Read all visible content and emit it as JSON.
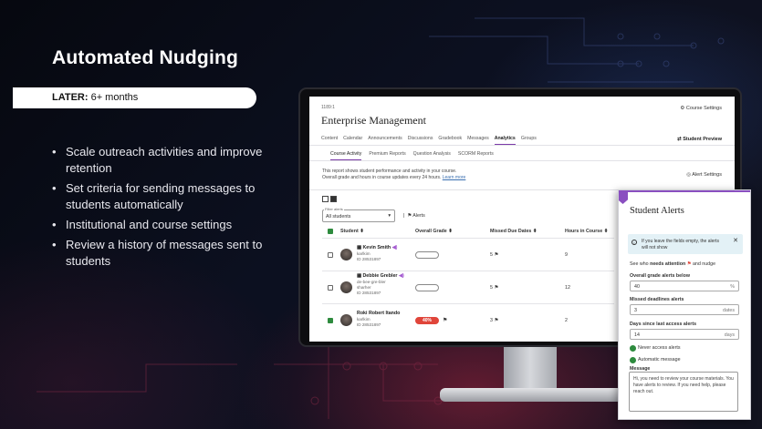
{
  "slide": {
    "title": "Automated Nudging",
    "phase_label": "LATER:",
    "phase_value": "6+ months",
    "bullets": [
      "Scale outreach activities and improve retention",
      "Set criteria for sending messages to students automatically",
      "Institutional and course settings",
      "Review a history of messages sent to students"
    ]
  },
  "app": {
    "breadcrumb": "1189:1",
    "course_title": "Enterprise Management",
    "course_settings": "Course Settings",
    "student_preview": "Student Preview",
    "nav_items": [
      "Content",
      "Calendar",
      "Announcements",
      "Discussions",
      "Gradebook",
      "Messages",
      "Analytics",
      "Groups"
    ],
    "nav_active": "Analytics",
    "sub_tabs": [
      "Course Activity",
      "Premium Reports",
      "Question Analysis",
      "SCORM Reports"
    ],
    "sub_active": "Course Activity",
    "description_line1": "This report shows student performance and activity in your course.",
    "description_line2": "Overall grade and hours in course updates every 24 hours.",
    "learn_more": "Learn more",
    "alert_settings": "Alert Settings",
    "filter_label": "Filter alerts",
    "filter_value": "All students",
    "alerts_button": "Alerts",
    "columns": [
      "Student",
      "Overall Grade",
      "Missed Due Dates",
      "Hours in Course"
    ],
    "rows": [
      {
        "name": "Kevin Smith",
        "user": "karlkim",
        "id": "ID 28531897",
        "grade": "",
        "missed": "5",
        "hours": "9",
        "checked": false
      },
      {
        "name": "Debbie Grebler",
        "alias": "de-bee-gre-bler",
        "user": "sharher",
        "id": "ID 28531897",
        "grade": "",
        "missed": "5",
        "hours": "12",
        "checked": false
      },
      {
        "name": "Roki Robert Itando",
        "user": "karlkim",
        "id": "ID 28531897",
        "grade": "40%",
        "missed": "3",
        "hours": "2",
        "checked": true
      }
    ]
  },
  "panel": {
    "title": "Student Alerts",
    "info": "If you leave the fields empty, the alerts will not show",
    "needs_prefix": "See who",
    "needs_bold": "needs attention",
    "needs_suffix": "and nudge",
    "grade_label": "Overall grade alerts below",
    "grade_value": "40",
    "grade_unit": "%",
    "missed_label": "Missed deadlines alerts",
    "missed_value": "3",
    "missed_unit": "dates",
    "days_label": "Days since last access alerts",
    "days_value": "14",
    "days_unit": "days",
    "toggle_never": "Never access alerts",
    "toggle_auto": "Automatic message",
    "message_label": "Message",
    "message_text": "Hi, you need to review your course materials. You have alerts to review. If you need help, please reach out."
  },
  "colors": {
    "accent": "#8a4fc0",
    "success": "#2e8b3e",
    "danger": "#e0453a"
  }
}
